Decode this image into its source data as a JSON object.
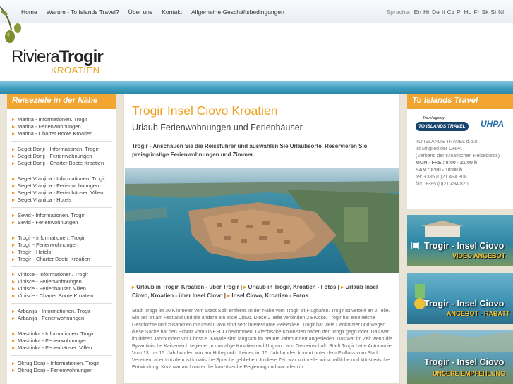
{
  "header": {
    "nav": [
      "Home",
      "Warum - To Islands Travel?",
      "Über uns",
      "Kontakt",
      "Allgemeine Geschäftsbedingungen"
    ],
    "language_label": "Sprache:",
    "languages": [
      "En",
      "Hr",
      "De",
      "It",
      "Cz",
      "Pl",
      "Hu",
      "Fr",
      "Sk",
      "Sl",
      "Nl"
    ],
    "logo_main": "Riviera",
    "logo_bold": "Trogir",
    "logo_sub": "KROATIEN"
  },
  "left": {
    "heading": "Reiseziele in der Nähe",
    "groups": [
      [
        "Marina - Informationen. Trogir",
        "Marina - Ferienwohnungen",
        "Marina - Charter Boote Kroatien"
      ],
      [
        "Seget Donji - Informationen. Trogir",
        "Seget Donji - Ferienwohnungen",
        "Seget Donji - Charter Boote Kroatien"
      ],
      [
        "Seget Vranjica - Informationen. Trogir",
        "Seget Vranjica - Ferienwohnungen",
        "Seget Vranjica - Ferienhäuser. Villen",
        "Seget Vranjica - Hotels"
      ],
      [
        "Sevid - Informationen. Trogir",
        "Sevid - Ferienwohnungen"
      ],
      [
        "Trogir - Informationen. Trogir",
        "Trogir - Ferienwohnungen",
        "Trogir - Hotels",
        "Trogir - Charter Boote Kroatien"
      ],
      [
        "Vinisce - Informationen. Trogir",
        "Vinisce - Ferienwohnungen",
        "Vinisce - Ferienhäuser. Villen",
        "Vinisce - Charter Boote Kroatien"
      ],
      [
        "Arbanija - Informationen. Trogir",
        "Arbanija - Ferienwohnungen"
      ],
      [
        "Mastrinka - Informationen. Trogir",
        "Mastrinka - Ferienwohnungen",
        "Mastrinka - Ferienhäuser. Villen"
      ],
      [
        "Okrug Donji - Informationen. Trogir",
        "Okrug Donji - Ferienwohnungen"
      ]
    ]
  },
  "main": {
    "title": "Trogir Insel Ciovo Kroatien",
    "subtitle": "Urlaub Ferienwohnungen und Ferienhäuser",
    "intro": "Trogir - Anschauen Sie die Reiseführer und auswählen Sie Urlaubsorte. Reservieren Sie preisgünstige Ferienwohnungen und Zimmer.",
    "links": [
      "Urlaub in Trogir, Kroatien - über Trogir",
      "Urlaub in Trogir, Kroatien - Fotos",
      "Urlaub Insel Ciovo, Kroatien - über Insel Ciovo",
      "Insel Ciovo, Kroatien - Fotos"
    ],
    "body": "Stadt Trogir ist 30 Kilometer vom Stadt Split entfernt. In der Nähe vom Trogir ist Flughafen. Trogir ist verteilt an 2 Teile. Ein Teil ist am Festland und die andere am Insel Ciovo. Diese 2 Teile verbinden 2 Brücke. Trogir hat eine reiche Geschichte und zusammen mit Insel Ciovo sind sehr interessante Reiseziele. Trogir hat viele Denkmäler und wegen diese Sache hat den Schutz vom UNESCO bekommen. Griechische Kolonisten haben den Trogir gegründet. Das war im dritten Jahrhundert vor Christus. Kroatie sind langsam im neunte Jahrhundert angesiedelt. Das war im Zeit wenn die Byzantinische Kaiserreich regierte. In damalige Kroatien und Ungarn Land Gemeinschaft. Stadt Trogir hatte Autonomie. Vom 13. bis 15. Jahrhundert war am Höhepunkt. Leider, im 15. Jahrhundert kommt unter dem Einfluss vom Stadt Venetien, aber trotzdem ist kroatische Sprache geblieben. In diese Zeit war kulturelle, wirschaftliche und künstlerische Entwicklung. Kurz war auch unter die französische Regierung und nachdem in"
  },
  "right": {
    "heading": "To Islands Travel",
    "logo_small": "Travel agency",
    "logo_name": "TO ISLANDS TRAVEL",
    "uhpa": "UHPA",
    "company": [
      "TO ISLANDS TRAVEL d.o.o.",
      "ist Mitglied der UHPA",
      "(Verband der Kroatischen Reisebüros)",
      "MON - FRE : 8:00 - 21:00 h",
      "SAM : 8:00 - 18:00 h",
      "tel: +385 (0)21 494 808",
      "fax: +385 (0)21 494 820"
    ],
    "promos": [
      {
        "title": "Trogir - Insel Ciovo",
        "sub": "VIDEO ANGEBOT"
      },
      {
        "title": "Trogir - Insel Ciovo",
        "sub": "ANGEBOT - RABATT"
      },
      {
        "title": "Trogir - Insel Ciovo",
        "sub": "UNSERE EMPFEHLUNG"
      }
    ]
  },
  "colors": {
    "accent": "#f0a020",
    "sea": "#3c9dbc",
    "background": "#e9e4d6"
  }
}
